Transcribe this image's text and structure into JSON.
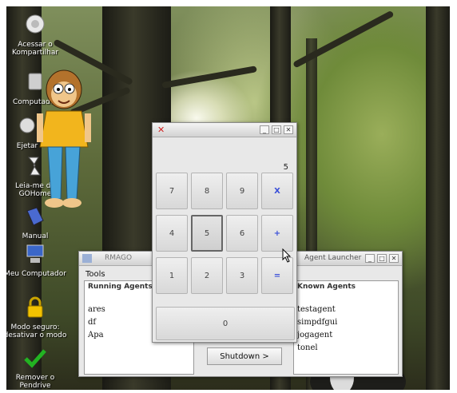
{
  "desktop": {
    "icons": [
      {
        "label": "Acessar o Kompartilhar",
        "icon": "network-icon"
      },
      {
        "label": "Computador",
        "icon": "computer-icon"
      },
      {
        "label": "Ejetar",
        "icon": "eject-icon"
      },
      {
        "label": "Leia-me do GOHome",
        "icon": "readme-icon"
      },
      {
        "label": "Manual",
        "icon": "manual-icon"
      },
      {
        "label": "Meu Computador",
        "icon": "my-computer-icon"
      },
      {
        "label": "Modo seguro: desativar o modo",
        "icon": "lock-icon"
      },
      {
        "label": "Remover o Pendrive",
        "icon": "checkmark-icon"
      }
    ]
  },
  "agent_window": {
    "title": "RMAGO",
    "menu_tools": "Tools",
    "running_header": "Running Agents",
    "running_agents": [
      "ares",
      "df",
      "Apa"
    ],
    "known_window_title": "Agent Launcher",
    "known_header": "Known Agents",
    "known_agents": [
      "testagent",
      "simpdfgui",
      "jogagent",
      "tonel"
    ],
    "shutdown_label": "Shutdown >"
  },
  "calculator": {
    "close_glyph": "✕",
    "min_glyph": "_",
    "max_glyph": "□",
    "display": "5",
    "keys": [
      {
        "label": "7",
        "kind": "digit",
        "pressed": false
      },
      {
        "label": "8",
        "kind": "digit",
        "pressed": false
      },
      {
        "label": "9",
        "kind": "digit",
        "pressed": false
      },
      {
        "label": "X",
        "kind": "op",
        "pressed": false
      },
      {
        "label": "4",
        "kind": "digit",
        "pressed": false
      },
      {
        "label": "5",
        "kind": "digit",
        "pressed": true
      },
      {
        "label": "6",
        "kind": "digit",
        "pressed": false
      },
      {
        "label": "+",
        "kind": "op",
        "pressed": false
      },
      {
        "label": "1",
        "kind": "digit",
        "pressed": false
      },
      {
        "label": "2",
        "kind": "digit",
        "pressed": false
      },
      {
        "label": "3",
        "kind": "digit",
        "pressed": false
      },
      {
        "label": "=",
        "kind": "op",
        "pressed": false
      }
    ],
    "zero_label": "0"
  },
  "colors": {
    "accent_close": "#d02020",
    "operator_text": "#3a4fd8"
  }
}
